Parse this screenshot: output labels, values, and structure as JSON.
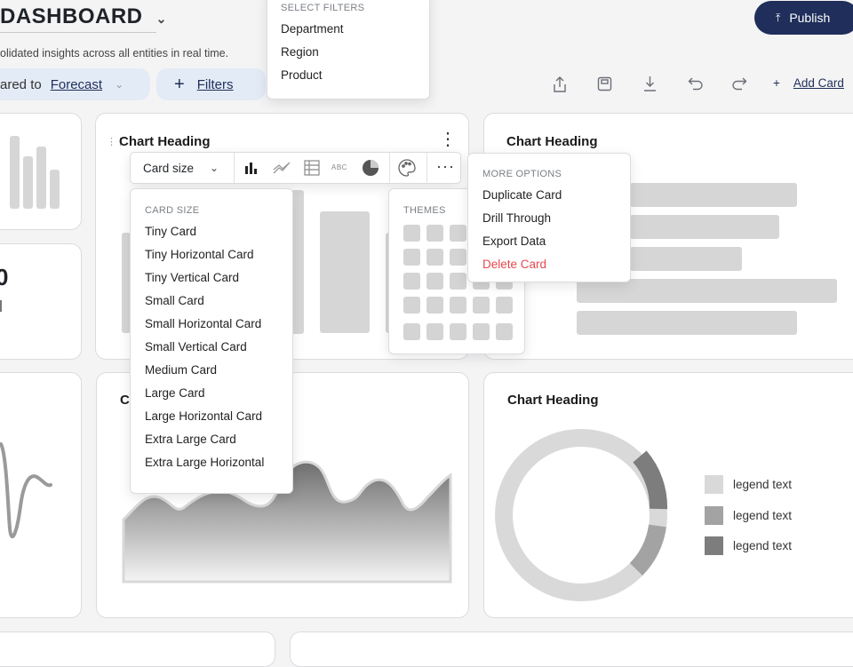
{
  "header": {
    "title": "DASHBOARD",
    "subtitle": "olidated insights across all entities in real time.",
    "compared_prefix": "ared to",
    "compared_value": "Forecast",
    "filters_label": "Filters",
    "publish_label": "Publish",
    "add_card_label": "Add Card"
  },
  "filter_menu": {
    "title": "SELECT FILTERS",
    "items": [
      "Department",
      "Region",
      "Product"
    ]
  },
  "cards": {
    "left_number": "0",
    "main_heading": "Chart Heading",
    "right_heading": "Chart Heading",
    "area_heading_partial": "C",
    "donut_heading": "Chart Heading"
  },
  "card_toolbar": {
    "card_size_label": "Card size",
    "abc_label": "ABC"
  },
  "card_size_menu": {
    "title": "CARD SIZE",
    "items": [
      "Tiny Card",
      "Tiny Horizontal Card",
      "Tiny Vertical Card",
      "Small Card",
      "Small Horizontal Card",
      "Small Vertical Card",
      "Medium Card",
      "Large Card",
      "Large Horizontal Card",
      "Extra Large Card",
      "Extra Large Horizontal"
    ]
  },
  "themes_menu": {
    "title": "THEMES"
  },
  "more_options_menu": {
    "title": "MORE OPTIONS",
    "items": [
      "Duplicate Card",
      "Drill Through",
      "Export Data"
    ],
    "danger_item": "Delete Card"
  },
  "legend": {
    "items": [
      "legend text",
      "legend text",
      "legend text"
    ],
    "colors": [
      "#d9d9d9",
      "#a3a3a3",
      "#7d7d7d"
    ]
  },
  "colors": {
    "accent_navy": "#1f2e5a",
    "pill_bg": "#e3ebf6",
    "danger": "#e5484d"
  }
}
